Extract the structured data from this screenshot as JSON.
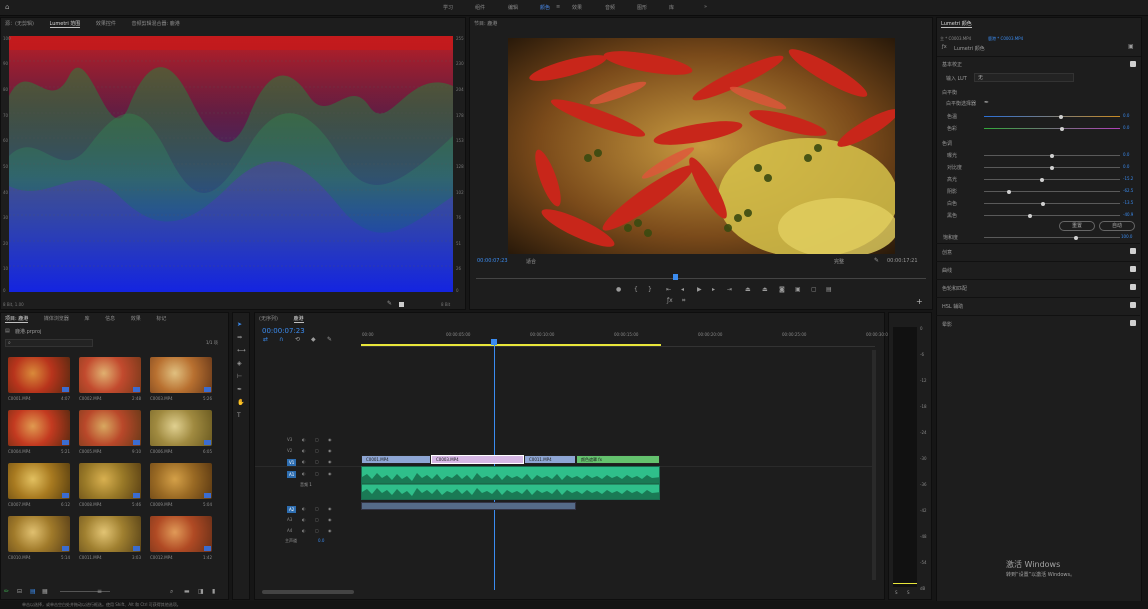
{
  "topbar": {
    "workspaces": [
      "学习",
      "组件",
      "编辑",
      "颜色",
      "效果",
      "音频",
      "图形",
      "库"
    ],
    "active_workspace": "颜色",
    "more": "»"
  },
  "scope_panel": {
    "tabs": [
      "源：(无剪辑)",
      "Lumetri 范围",
      "效果控件",
      "音频剪辑混合器: 鹿港"
    ],
    "left_scale": [
      "100",
      "90",
      "80",
      "70",
      "60",
      "50",
      "40",
      "30",
      "20",
      "10",
      "0"
    ],
    "right_scale": [
      "255",
      "230",
      "204",
      "178",
      "153",
      "128",
      "102",
      "76",
      "51",
      "26",
      "0"
    ],
    "bottom_left": "8 Bit, 1.00",
    "bottom_right": "8 Bit"
  },
  "program_monitor": {
    "title": "节目: 鹿港",
    "timecode_current": "00:00:07:23",
    "fit": "适合",
    "quality": "完整",
    "timecode_total": "00:00:17:21"
  },
  "lumetri": {
    "panel_title": "Lumetri 颜色",
    "breadcrumb_left": "主 * C0003.MP4",
    "breadcrumb_right": "鹿港 * C0003.MP4",
    "effect_name": "Lumetri 颜色",
    "basic_section": "基本校正",
    "lut_label": "输入 LUT",
    "lut_value": "无",
    "white_balance": "白平衡",
    "wb_selector": "白平衡选择器",
    "temperature_label": "色温",
    "temperature_value": "0.0",
    "tint_label": "色彩",
    "tint_value": "0.0",
    "tone": "色调",
    "exposure_label": "曝光",
    "exposure_value": "0.0",
    "contrast_label": "对比度",
    "contrast_value": "0.0",
    "highlights_label": "高光",
    "highlights_value": "-15.2",
    "shadows_label": "阴影",
    "shadows_value": "-62.5",
    "whites_label": "白色",
    "whites_value": "-13.5",
    "blacks_label": "黑色",
    "blacks_value": "-40.9",
    "reset_button": "重置",
    "auto_button": "自动",
    "saturation_label": "饱和度",
    "saturation_value": "100.0",
    "sections": [
      "创意",
      "曲线",
      "色轮和匹配",
      "HSL 辅助",
      "晕影"
    ]
  },
  "project_panel": {
    "tabs": [
      "项目: 鹿港",
      "媒体浏览器",
      "库",
      "信息",
      "效果",
      "标记"
    ],
    "project_name": "鹿港.prproj",
    "count": "1/1 项",
    "items": [
      {
        "name": "C0001.MP4",
        "dur": "4:07"
      },
      {
        "name": "C0002.MP4",
        "dur": "2:48"
      },
      {
        "name": "C0003.MP4",
        "dur": "5:26"
      },
      {
        "name": "C0004.MP4",
        "dur": "5:21"
      },
      {
        "name": "C0005.MP4",
        "dur": "9:10"
      },
      {
        "name": "C0006.MP4",
        "dur": "6:05"
      },
      {
        "name": "C0007.MP4",
        "dur": "6:12"
      },
      {
        "name": "C0008.MP4",
        "dur": "5:46"
      },
      {
        "name": "C0009.MP4",
        "dur": "5:04"
      },
      {
        "name": "C0010.MP4",
        "dur": "5:14"
      },
      {
        "name": "C0011.MP4",
        "dur": "3:03"
      },
      {
        "name": "C0012.MP4",
        "dur": "1:42"
      }
    ]
  },
  "timeline": {
    "tabs": [
      "(无序列)",
      "鹿港"
    ],
    "timecode": "00:00:07:23",
    "ruler": [
      "00:00",
      "00:00:05:00",
      "00:00:10:00",
      "00:00:15:00",
      "00:00:20:00",
      "00:00:25:00",
      "00:00:30:00"
    ],
    "video_tracks": [
      "V3",
      "V2",
      "V1"
    ],
    "audio_tracks": [
      "A1",
      "A2",
      "A3",
      "A4"
    ],
    "master_label": "主声道",
    "master_value": "0.0",
    "audio_name": "音频 1",
    "clips": [
      {
        "name": "C0001.MP4",
        "color": "#8ea6d4"
      },
      {
        "name": "C0003.MP4",
        "color": "#d7b8e6"
      },
      {
        "name": "C0011.MP4",
        "color": "#8ea6d4"
      },
      {
        "name": "颜色遮罩 fx",
        "color": "#64c26e"
      }
    ]
  },
  "meter": {
    "scale": [
      "0",
      "-6",
      "-12",
      "-18",
      "-24",
      "-30",
      "-36",
      "-42",
      "-48",
      "-54",
      "dB"
    ],
    "buttons": [
      "S",
      "S"
    ]
  },
  "status": {
    "text": "单击以选择，或单击空白处并拖动以进行框选。使用 Shift、Alt 和 Ctrl 可获得其他选项。"
  },
  "watermark": {
    "line1": "激活 Windows",
    "line2": "转到“设置”以激活 Windows。"
  },
  "colors": {
    "accent": "#3b8cf0",
    "audio_clip": "#2fbf8a",
    "video_clip": "#8ea6d4",
    "color_matte": "#64c26e",
    "workarea": "#e8e63a"
  }
}
